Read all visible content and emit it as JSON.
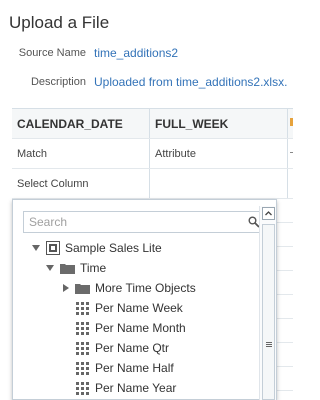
{
  "dialog": {
    "title": "Upload a File",
    "source_label": "Source Name",
    "source_value": "time_additions2",
    "description_label": "Description",
    "description_value": "Uploaded from time_additions2.xlsx."
  },
  "grid": {
    "columns": [
      "CALENDAR_DATE",
      "FULL_WEEK"
    ],
    "match_row": [
      "Match",
      "Attribute"
    ],
    "select_row": [
      "Select Column",
      ""
    ]
  },
  "popup": {
    "search_placeholder": "Search",
    "tree": {
      "root": "Sample Sales Lite",
      "folder": "Time",
      "subfolder": "More Time Objects",
      "columns": [
        "Per Name Week",
        "Per Name Month",
        "Per Name Qtr",
        "Per Name Half",
        "Per Name Year"
      ]
    }
  },
  "colors": {
    "link": "#3373b8",
    "accent_orange": "#e6a23c",
    "border": "#c4ced7"
  },
  "icons": [
    "search-icon",
    "subject-area-icon",
    "folder-icon",
    "column-icon",
    "expand-triangle-icon",
    "collapse-triangle-icon",
    "scroll-up-icon",
    "scroll-grip-icon"
  ]
}
